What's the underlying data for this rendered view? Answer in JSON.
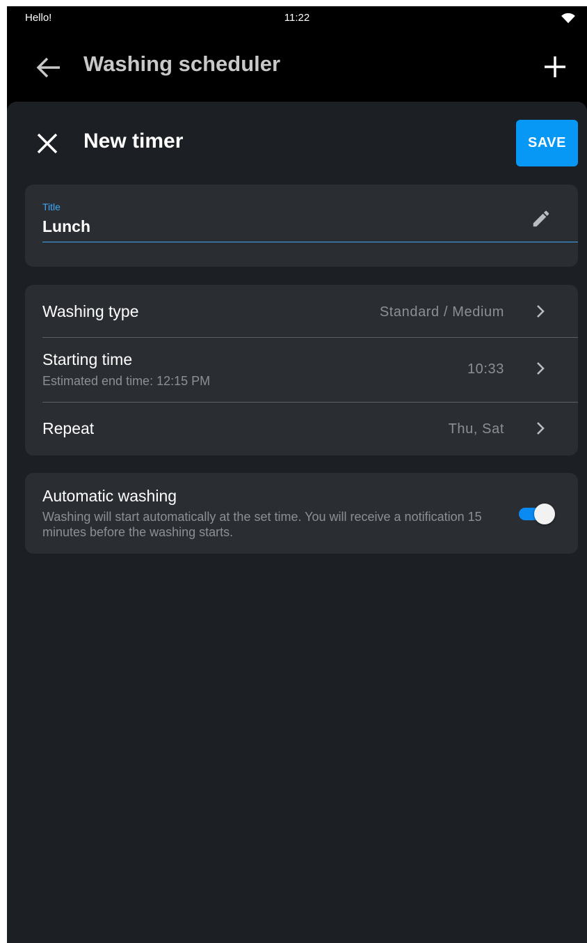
{
  "status_bar": {
    "left_text": "Hello!",
    "time": "11:22",
    "wifi_icon": "wifi-icon"
  },
  "app_bar": {
    "title": "Washing scheduler",
    "back_icon": "arrow-left-icon",
    "add_icon": "plus-icon"
  },
  "sheet": {
    "title": "New timer",
    "close_icon": "close-icon",
    "save_label": "SAVE",
    "accent_color": "#0797f5"
  },
  "title_field": {
    "label": "Title",
    "value": "Lunch",
    "edit_icon": "pencil-icon"
  },
  "settings": {
    "washing_type": {
      "label": "Washing type",
      "value": "Standard / Medium"
    },
    "starting_time": {
      "label": "Starting time",
      "sub": "Estimated end time: 12:15 PM",
      "value": "10:33"
    },
    "repeat": {
      "label": "Repeat",
      "value": "Thu, Sat"
    }
  },
  "automatic_washing": {
    "title": "Automatic washing",
    "description": "Washing will start automatically at the set time. You will receive a notification 15 minutes before the washing starts.",
    "enabled": true
  }
}
